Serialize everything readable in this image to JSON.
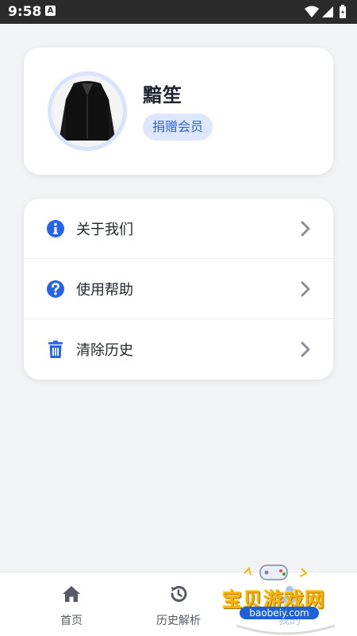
{
  "status_bar": {
    "time": "9:58",
    "indicator": "A"
  },
  "profile": {
    "name": "黯笙",
    "badge": "捐赠会员"
  },
  "menu": [
    {
      "label": "关于我们",
      "icon": "info-icon"
    },
    {
      "label": "使用帮助",
      "icon": "help-icon"
    },
    {
      "label": "清除历史",
      "icon": "trash-icon"
    }
  ],
  "nav": [
    {
      "label": "首页",
      "icon": "home-icon"
    },
    {
      "label": "历史解析",
      "icon": "history-icon"
    },
    {
      "label": "我的",
      "icon": "user-icon"
    }
  ],
  "watermark": {
    "text": "宝贝游戏网",
    "url": "baobeiy.com"
  },
  "colors": {
    "accent": "#2f65d6",
    "icon_blue": "#2563eb",
    "background": "#f2f3f5"
  }
}
